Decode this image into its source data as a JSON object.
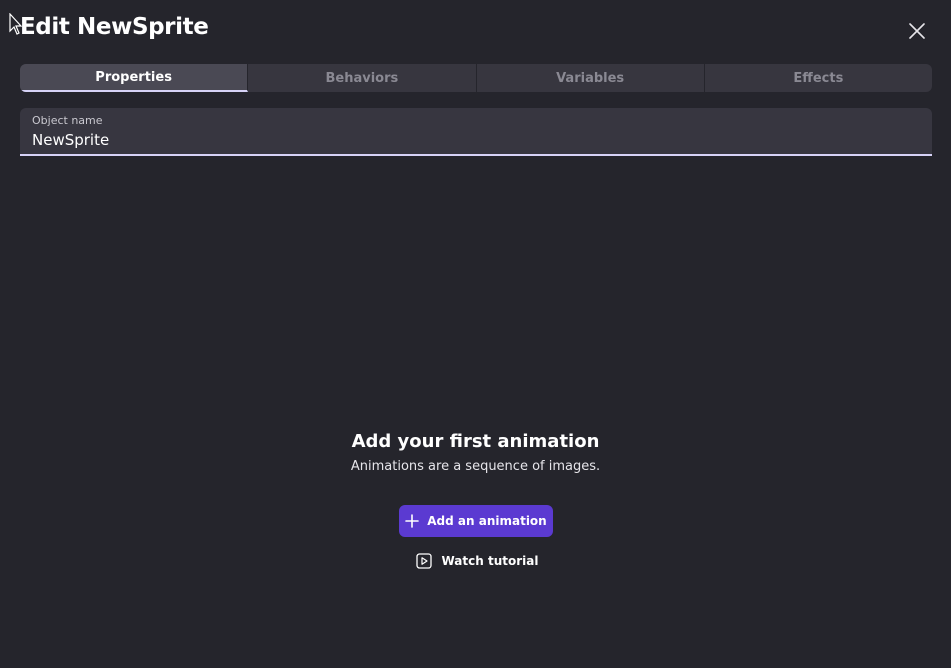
{
  "dialog": {
    "title": "Edit NewSprite",
    "close_icon": "close-icon"
  },
  "tabs": [
    {
      "label": "Properties",
      "active": true
    },
    {
      "label": "Behaviors",
      "active": false
    },
    {
      "label": "Variables",
      "active": false
    },
    {
      "label": "Effects",
      "active": false
    }
  ],
  "object_name": {
    "label": "Object name",
    "value": "NewSprite"
  },
  "empty_state": {
    "title": "Add your first animation",
    "description": "Animations are a sequence of images.",
    "add_button": {
      "label": "Add an animation",
      "icon": "plus-icon"
    },
    "tutorial_button": {
      "label": "Watch tutorial",
      "icon": "play-icon"
    }
  },
  "colors": {
    "background": "#25252c",
    "accent": "#5b3ad1",
    "tab_indicator": "#d7d3f7"
  }
}
